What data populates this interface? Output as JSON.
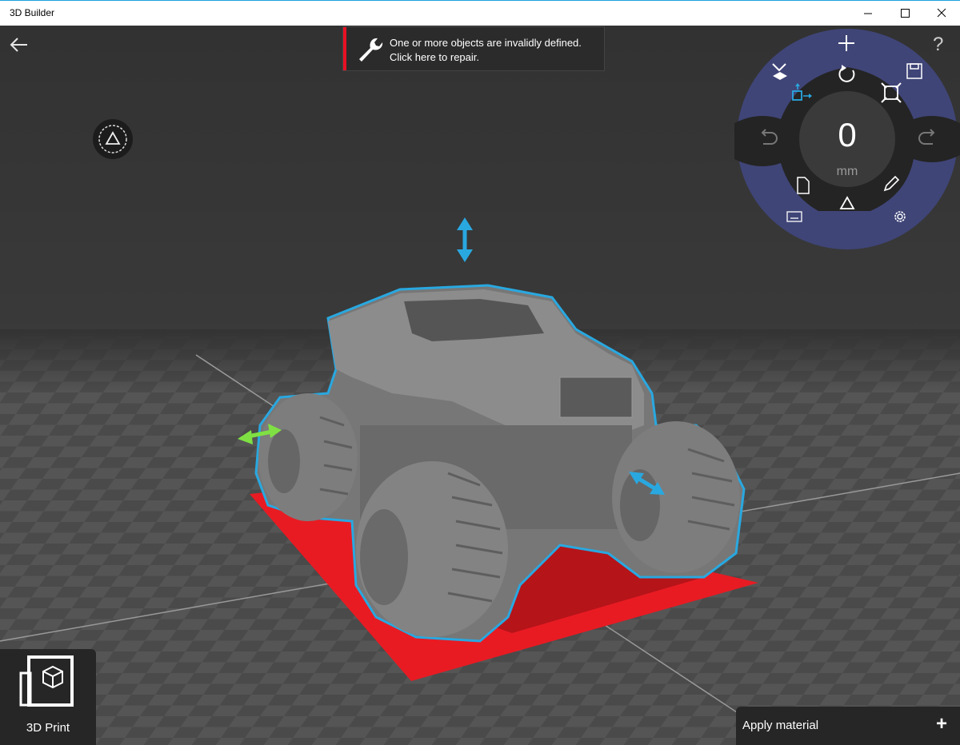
{
  "window": {
    "title": "3D Builder"
  },
  "notification": {
    "message": "One or more objects are invalidly defined. Click here to repair."
  },
  "controls": {
    "help_label": "?",
    "dimension_value": "0",
    "dimension_unit": "mm"
  },
  "print_tile": {
    "label": "3D Print"
  },
  "material_panel": {
    "label": "Apply material",
    "add_label": "+"
  },
  "colors": {
    "selection_outline": "#29a8e0",
    "floor_pad": "#e81b23",
    "green_arrow": "#7fe043",
    "wheel_ring": "#3f4577",
    "wheel_inner": "#242424",
    "accent": "#1ba1e2"
  },
  "icons": [
    "back-arrow-icon",
    "wrench-icon",
    "minimize-icon",
    "maximize-icon",
    "close-icon",
    "mode-triangle-icon",
    "add-icon",
    "help-icon",
    "drop-to-floor-icon",
    "rotate-icon",
    "move-icon",
    "scale-icon",
    "save-icon",
    "undo-icon",
    "redo-icon",
    "file-icon",
    "edit-pencil-icon",
    "triangle-mode-icon",
    "keyboard-icon",
    "settings-gear-icon",
    "print-3d-icon"
  ]
}
